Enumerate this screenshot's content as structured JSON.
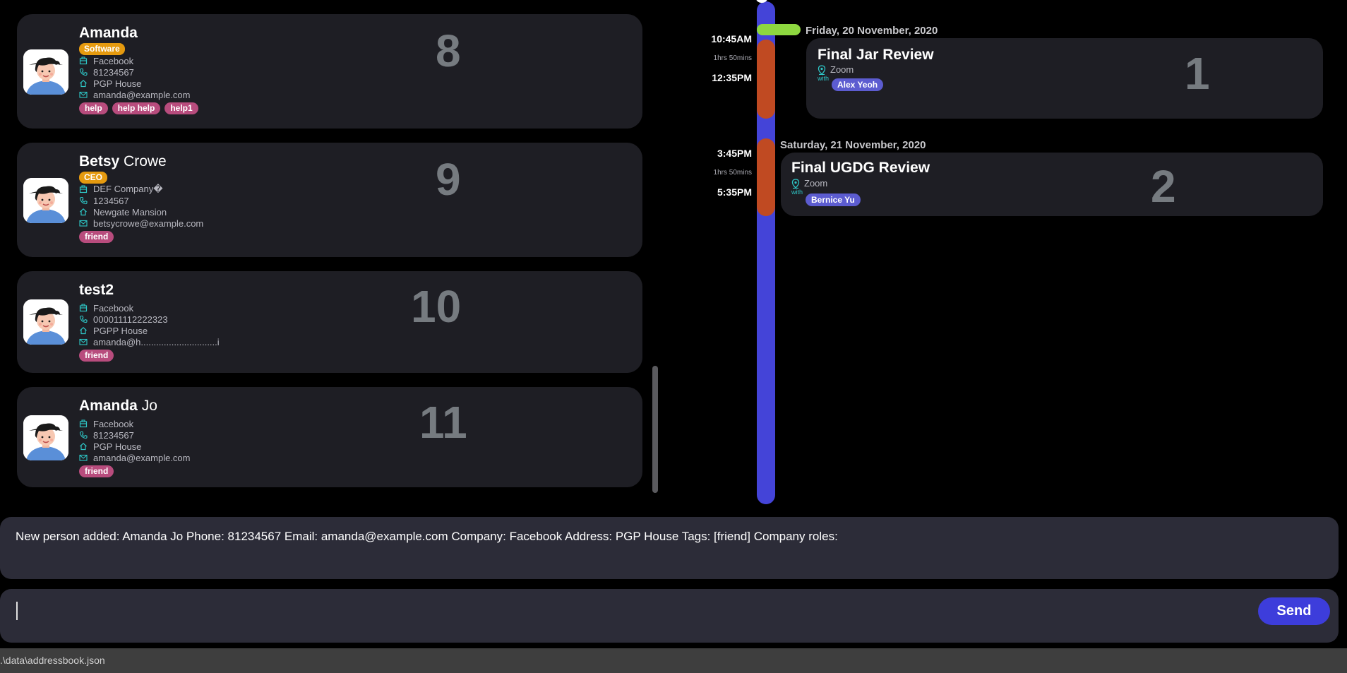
{
  "persons": [
    {
      "first_name": "Amanda",
      "last_name": "",
      "role": "Software",
      "company": "Facebook",
      "phone": "81234567",
      "address": "PGP House",
      "email": "amanda@example.com",
      "tags": [
        "help",
        "help help",
        "help1"
      ],
      "index": "8"
    },
    {
      "first_name": "Betsy",
      "last_name": "Crowe",
      "role": "CEO",
      "company": "DEF Company�",
      "phone": "1234567",
      "address": "Newgate Mansion",
      "email": "betsycrowe@example.com",
      "tags": [
        "friend"
      ],
      "index": "9"
    },
    {
      "first_name": "test2",
      "last_name": "",
      "role": "",
      "company": "Facebook",
      "phone": "000011112222323",
      "address": "PGPP House",
      "email": "amanda@h..............................i",
      "tags": [
        "friend"
      ],
      "index": "10"
    },
    {
      "first_name": "Amanda",
      "last_name": "Jo",
      "role": "",
      "company": "Facebook",
      "phone": "81234567",
      "address": "PGP House",
      "email": "amanda@example.com",
      "tags": [
        "friend"
      ],
      "index": "11"
    }
  ],
  "timeline": {
    "events": [
      {
        "start": "10:45AM",
        "end": "12:35PM",
        "duration": "1hrs 50mins",
        "day": "Friday, 20 November, 2020",
        "title": "Final Jar Review",
        "location": "Zoom",
        "with_label": "with",
        "attendee": "Alex Yeoh",
        "index": "1"
      },
      {
        "start": "3:45PM",
        "end": "5:35PM",
        "duration": "1hrs 50mins",
        "day": "Saturday, 21 November, 2020",
        "title": "Final UGDG Review",
        "location": "Zoom",
        "with_label": "with",
        "attendee": "Bernice Yu",
        "index": "2"
      }
    ]
  },
  "result": {
    "text": "New person added: Amanda Jo Phone: 81234567 Email: amanda@example.com Company: Facebook Address: PGP House Tags: [friend] Company roles:"
  },
  "command": {
    "value": "",
    "send_label": "Send"
  },
  "status_bar": {
    "path": ".\\data\\addressbook.json"
  },
  "colors": {
    "card_bg": "#1e1e24",
    "role_badge": "#e59a0f",
    "tag": "#b84c7d",
    "timeline_track": "#4444d8",
    "event_segment": "#c04a22",
    "now_marker": "#8ed840",
    "attendee_badge": "#5c5cd0",
    "send_button": "#3d3ddb"
  },
  "icons": [
    "avatar-icon",
    "company-icon",
    "phone-icon",
    "home-icon",
    "email-icon",
    "location-pin-icon"
  ]
}
